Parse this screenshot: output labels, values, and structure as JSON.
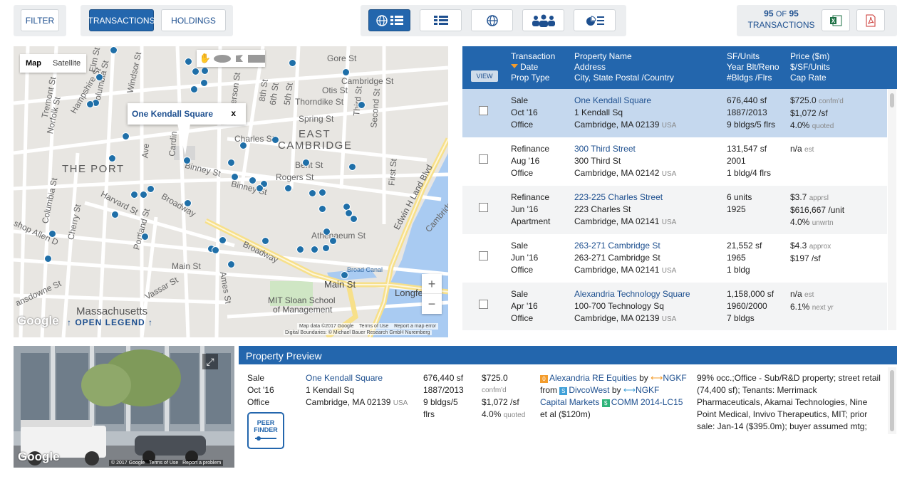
{
  "toolbar": {
    "filter_label": "FILTER",
    "transactions_label": "TRANSACTIONS",
    "holdings_label": "HOLDINGS",
    "count_prefix": "95",
    "count_of": "OF",
    "count_total": "95",
    "count_label": "TRANSACTIONS"
  },
  "map": {
    "map_label": "Map",
    "satellite_label": "Satellite",
    "popup_title": "One Kendall Square",
    "popup_close": "x",
    "zoom_in": "+",
    "zoom_out": "−",
    "legend_link": "↑ OPEN LEGEND ↑",
    "attribution_1": "Map data ©2017 Google",
    "attribution_2": "Terms of Use",
    "attribution_3": "Report a map error",
    "attribution_4": "Digital Boundaries: © Michael Bauer Research GmbH Nuremberg",
    "google_logo": "Google",
    "labels": {
      "east_cambridge_1": "EAST",
      "east_cambridge_2": "CAMBRIDGE",
      "the_port": "THE PORT",
      "massachusetts": "Massachusetts",
      "mit_sloan_1": "MIT Sloan School",
      "mit_sloan_2": "of Management",
      "gore_st": "Gore St",
      "cambridge_st": "Cambridge St",
      "otis_st": "Otis St",
      "thorndike_st": "Thorndike St",
      "spring_st": "Spring St",
      "charles_st": "Charles St",
      "bent_st": "Bent St",
      "rogers_st": "Rogers St",
      "binney_st_1": "Binney St",
      "binney_st_2": "Binney St",
      "athenaeum_st": "Athenaeum St",
      "broadway_1": "Broadway",
      "broadway_2": "Broadway",
      "main_st_1": "Main St",
      "main_st_2": "Main St",
      "harvard_st": "Harvard St",
      "vassar_st": "Vassar St",
      "amesst": "Ames St",
      "edwin_h_land": "Edwin H Land Blvd",
      "broad_canal": "Broad Canal",
      "longfellow": "Longfe",
      "first_st": "First St",
      "third_st": "Third St",
      "second_st": "Second St",
      "eighth_st": "8th St",
      "sixth_st": "6th St",
      "fifth_st": "5th St",
      "jackson_st": "ckerson St",
      "windsor_st": "Windsor St",
      "elm_st": "Elm St",
      "columbia_st_1": "Columbia St",
      "columbia_st_2": "Columbia St",
      "hampshire_st": "Hampshire St",
      "tremont_st": "Tremont St",
      "norfolk_st": "Norfolk St",
      "portland_st": "Portland St",
      "cherry_st": "Cherry St",
      "bishop_allen": "shop Allen D",
      "landsdowne": "ansdowne St",
      "cardinal": "Cardin",
      "galileo": "Ave",
      "cambridge_st_2": "Cambridge"
    }
  },
  "table": {
    "view_label": "VIEW",
    "headers": {
      "col1": [
        "Transaction",
        "Date",
        "Prop Type"
      ],
      "col2": [
        "Property Name",
        "Address",
        "City, State Postal /Country"
      ],
      "col3": [
        "SF/Units",
        "Year Blt/Reno",
        "#Bldgs /Flrs"
      ],
      "col4": [
        "Price ($m)",
        "$/SF/Units",
        "Cap Rate"
      ]
    },
    "rows": [
      {
        "type": "Sale",
        "date": "Oct '16",
        "prop": "Office",
        "name": "One Kendall Square",
        "address": "1 Kendall Sq",
        "city": "Cambridge, MA 02139",
        "country": "USA",
        "size": "676,440 sf",
        "year": "1887/2013",
        "bldgs": "9 bldgs/5 flrs",
        "price": "$725.0",
        "price_note": "confm'd",
        "persf": "$1,072 /sf",
        "persf_note": "",
        "cap": "4.0%",
        "cap_note": "quoted"
      },
      {
        "type": "Refinance",
        "date": "Aug '16",
        "prop": "Office",
        "name": "300 Third Street",
        "address": "300 Third St",
        "city": "Cambridge, MA 02142",
        "country": "USA",
        "size": "131,547 sf",
        "year": "2001",
        "bldgs": "1 bldg/4 flrs",
        "price": "n/a",
        "price_note": "est",
        "persf": "",
        "persf_note": "",
        "cap": "",
        "cap_note": ""
      },
      {
        "type": "Refinance",
        "date": "Jun '16",
        "prop": "Apartment",
        "name": "223-225 Charles Street",
        "address": "223 Charles St",
        "city": "Cambridge, MA 02141",
        "country": "USA",
        "size": "6 units",
        "year": "1925",
        "bldgs": "",
        "price": "$3.7",
        "price_note": "apprsl",
        "persf": "$616,667 /unit",
        "persf_note": "",
        "cap": "4.0%",
        "cap_note": "unwrtn"
      },
      {
        "type": "Sale",
        "date": "Jun '16",
        "prop": "Office",
        "name": "263-271 Cambridge St",
        "address": "263-271 Cambridge St",
        "city": "Cambridge, MA 02141",
        "country": "USA",
        "size": "21,552 sf",
        "year": "1965",
        "bldgs": "1 bldg",
        "price": "$4.3",
        "price_note": "approx",
        "persf": "$197 /sf",
        "persf_note": "",
        "cap": "",
        "cap_note": ""
      },
      {
        "type": "Sale",
        "date": "Apr '16",
        "prop": "Office",
        "name": "Alexandria Technology Square",
        "address": "100-700 Technology Sq",
        "city": "Cambridge, MA 02139",
        "country": "USA",
        "size": "1,158,000 sf",
        "year": "1960/2000",
        "bldgs": "7 bldgs",
        "price": "n/a",
        "price_note": "est",
        "persf": "6.1%",
        "persf_note": "next yr",
        "cap": "",
        "cap_note": ""
      }
    ]
  },
  "preview": {
    "title": "Property Preview",
    "type": "Sale",
    "date": "Oct '16",
    "prop": "Office",
    "name": "One Kendall Square",
    "address": "1 Kendall Sq",
    "city": "Cambridge, MA 02139",
    "country": "USA",
    "size": "676,440 sf",
    "year": "1887/2013",
    "bldgs_1": "9 bldgs/5",
    "bldgs_2": "flrs",
    "price": "$725.0",
    "price_note": "confm'd",
    "persf": "$1,072 /sf",
    "cap": "4.0%",
    "cap_note": "quoted",
    "buyer": "Alexandria RE Equities",
    "by1": "by",
    "broker1": "NGKF",
    "from": "from",
    "seller": "DivcoWest",
    "by2": "by",
    "broker2_1": "NGKF",
    "broker2_2": "Capital Markets",
    "lender": "COMM 2014-LC15",
    "lender_2": "et al ($120m)",
    "description": "99% occ.;Office - Sub/R&D property; street retail (74,400 sf); Tenants: Merrimack Pharmaceuticals, Akamai Technologies, Nine Point Medical, Invivo Therapeutics, MIT; prior sale: Jan-14 ($395.0m); buyer assumed mtg;",
    "peer_finder_1": "PEER",
    "peer_finder_2": "FINDER",
    "street_google": "Google",
    "street_attr_1": "© 2017 Google",
    "street_attr_2": "Terms of Use",
    "street_attr_3": "Report a problem"
  },
  "colors": {
    "primary": "#2366ad",
    "selected_row": "#c5d8ee",
    "map_dot": "#1f6fa8"
  }
}
